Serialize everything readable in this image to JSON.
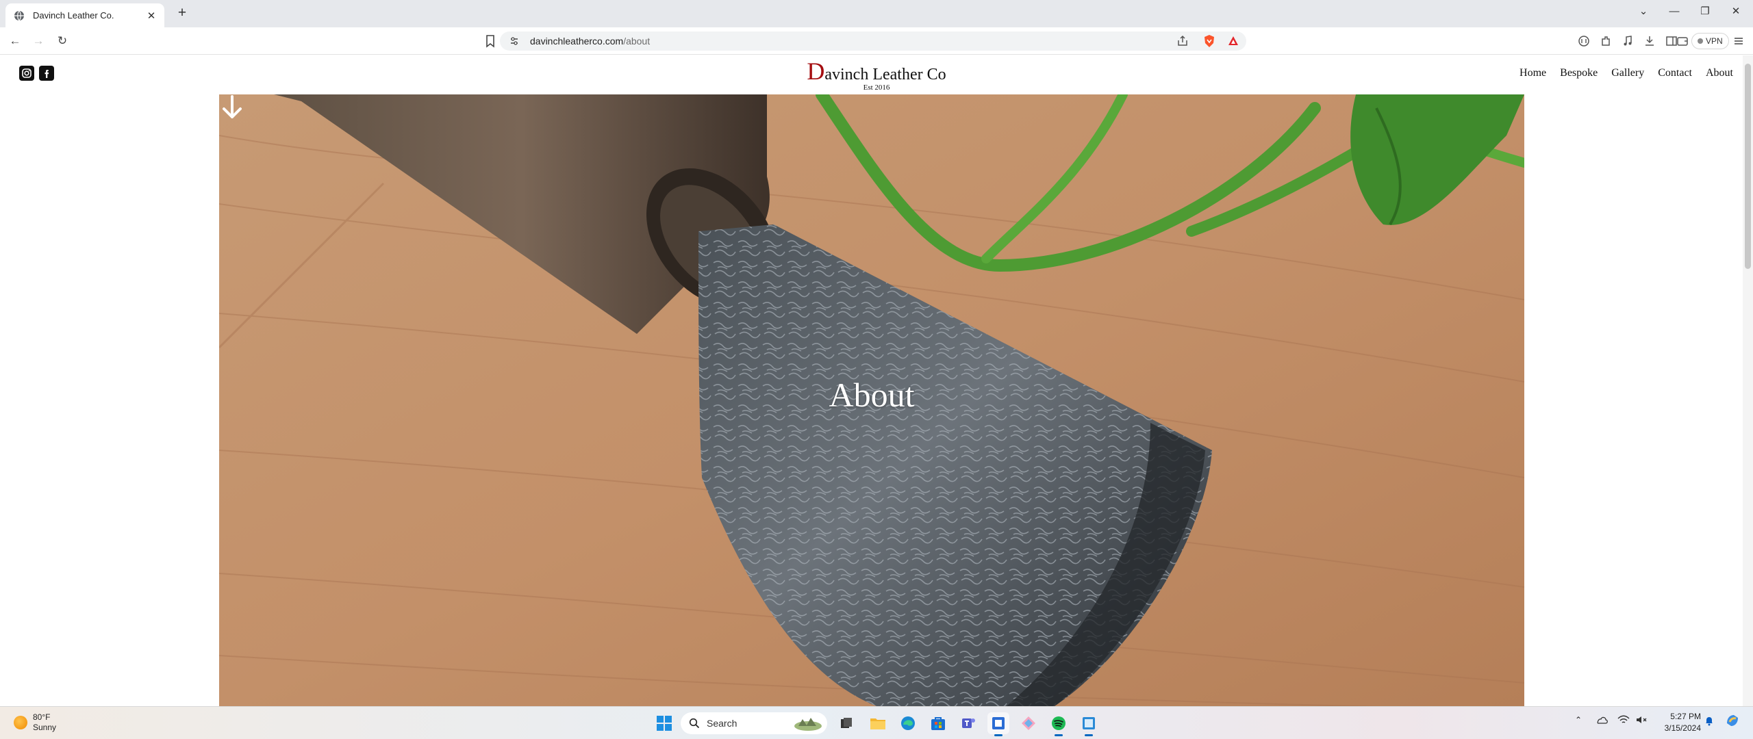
{
  "browser": {
    "tab": {
      "title": "Davinch Leather Co."
    },
    "address": {
      "host": "davinchleatherco.com",
      "path": "/about"
    },
    "vpn_label": "VPN"
  },
  "site": {
    "brand": {
      "initial": "D",
      "rest": "avinch Leather Co",
      "est": "Est 2016"
    },
    "social": [
      "instagram-icon",
      "facebook-icon"
    ],
    "nav": [
      "Home",
      "Bespoke",
      "Gallery",
      "Contact",
      "About"
    ],
    "hero": {
      "title": "About"
    },
    "colors": {
      "brand_red": "#a40d10",
      "text": "#111111"
    }
  },
  "taskbar": {
    "weather": {
      "temp": "80°F",
      "condition": "Sunny"
    },
    "search_label": "Search",
    "clock": {
      "time": "5:27 PM",
      "date": "3/15/2024"
    }
  }
}
